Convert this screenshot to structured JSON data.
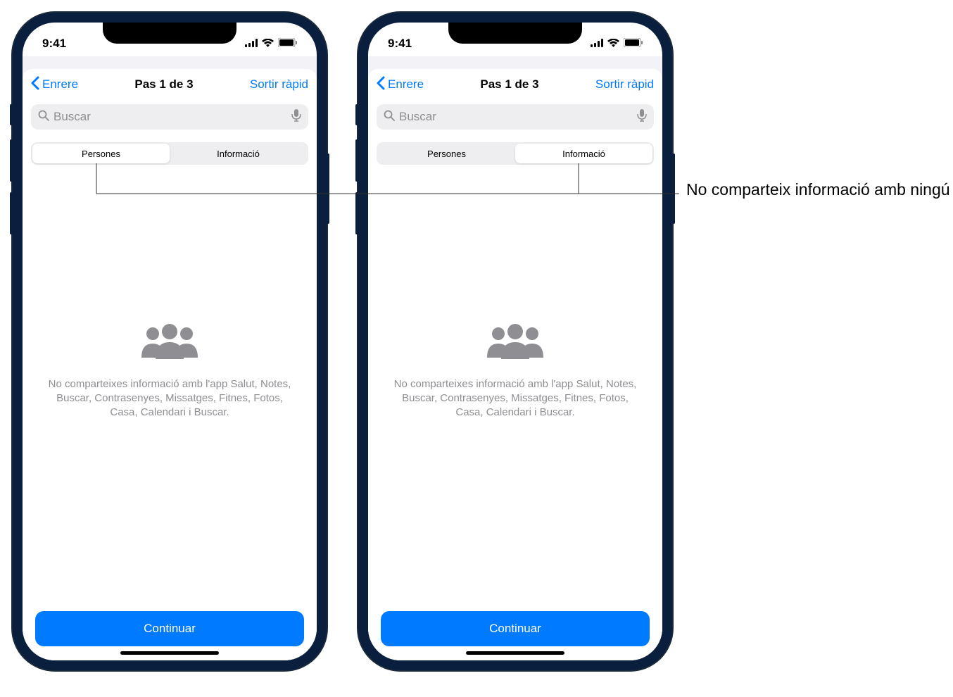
{
  "status": {
    "time": "9:41"
  },
  "nav": {
    "back": "Enrere",
    "title": "Pas 1 de 3",
    "quick_exit": "Sortir ràpid"
  },
  "search": {
    "placeholder": "Buscar"
  },
  "tabs": {
    "people": "Persones",
    "information": "Informació"
  },
  "empty": {
    "text": "No comparteixes informació amb l'app Salut, Notes, Buscar, Contrasenyes, Missatges, Fitnes, Fotos, Casa, Calendari i Buscar."
  },
  "continue": "Continuar",
  "callout": "No comparteix informació amb ningú"
}
